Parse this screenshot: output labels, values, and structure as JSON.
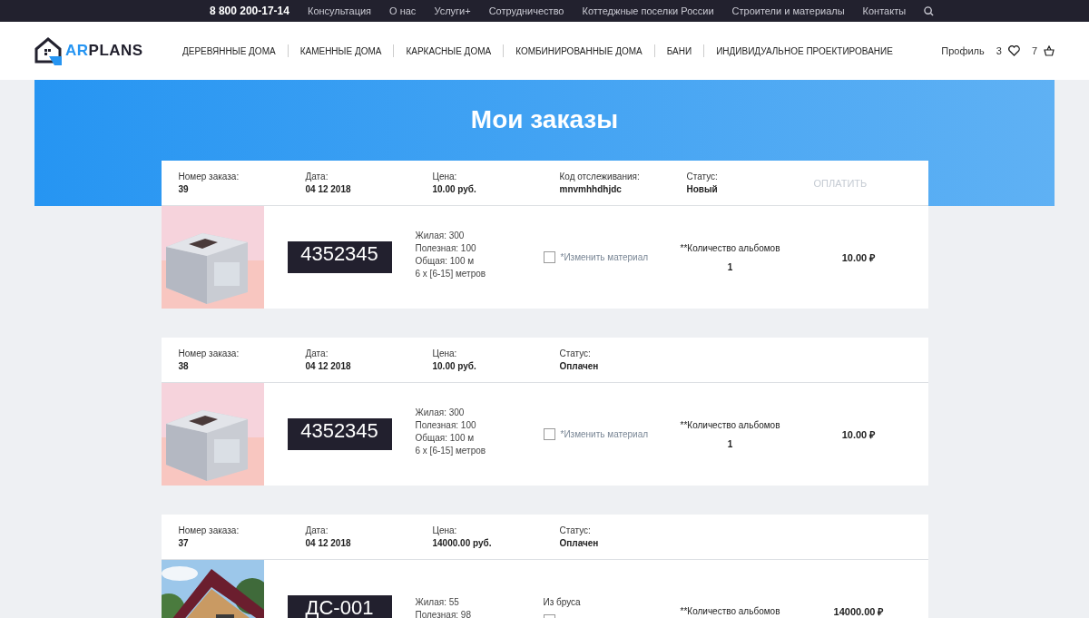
{
  "topbar": {
    "phone": "8 800 200-17-14",
    "links": [
      "Консультация",
      "О нас",
      "Услуги+",
      "Сотрудничество",
      "Коттеджные поселки России",
      "Строители и материалы",
      "Контакты"
    ]
  },
  "header": {
    "logo": {
      "accent": "AR",
      "rest": "PLANS"
    },
    "nav": [
      "ДЕРЕВЯННЫЕ ДОМА",
      "КАМЕННЫЕ ДОМА",
      "КАРКАСНЫЕ ДОМА",
      "КОМБИНИРОВАННЫЕ ДОМА",
      "БАНИ",
      "ИНДИВИДУАЛЬНОЕ ПРОЕКТИРОВАНИЕ"
    ],
    "profile": "Профиль",
    "favorites_count": "3",
    "cart_count": "7"
  },
  "title": "Мои заказы",
  "orders": [
    {
      "fields": [
        {
          "label": "Номер заказа:",
          "value": "39"
        },
        {
          "label": "Дата:",
          "value": "04 12 2018"
        },
        {
          "label": "Цена:",
          "value": "10.00 руб."
        },
        {
          "label": "Код отслеживания:",
          "value": "mnvmhhdhjdc"
        },
        {
          "label": "Статус:",
          "value": "Новый"
        }
      ],
      "pay_button": {
        "label": "ОПЛАТИТЬ",
        "disabled": true
      },
      "item": {
        "picture": {
          "kind": "picture"
        },
        "code": "4352345",
        "specs": [
          "Жилая: 300",
          "Полезная: 100",
          "Общая: 100 м",
          "6 x [6-15] метров"
        ],
        "checkbox": {
          "label": "*Изменить материал",
          "checked": false
        },
        "quantity_label": "**Количество альбомов",
        "quantity": "1",
        "price": "10.00 ₽"
      }
    },
    {
      "fields": [
        {
          "label": "Номер заказа:",
          "value": "38"
        },
        {
          "label": "Дата:",
          "value": "04 12 2018"
        },
        {
          "label": "Цена:",
          "value": "10.00 руб."
        },
        {
          "label": "Статус:",
          "value": "Оплачен"
        }
      ],
      "item": {
        "picture": {
          "kind": "picture"
        },
        "code": "4352345",
        "specs": [
          "Жилая: 300",
          "Полезная: 100",
          "Общая: 100 м",
          "6 x [6-15] метров"
        ],
        "checkbox": {
          "label": "*Изменить материал",
          "checked": false
        },
        "quantity_label": "**Количество альбомов",
        "quantity": "1",
        "price": "10.00 ₽"
      }
    },
    {
      "fields": [
        {
          "label": "Номер заказа:",
          "value": "37"
        },
        {
          "label": "Дата:",
          "value": "04 12 2018"
        },
        {
          "label": "Цена:",
          "value": "14000.00 руб."
        },
        {
          "label": "Статус:",
          "value": "Оплачен"
        }
      ],
      "item": {
        "picture": {
          "kind": "picture"
        },
        "code": "ДС-001",
        "specs": [
          "Жилая: 55",
          "Полезная: 98"
        ],
        "material": "Из бруса",
        "checkbox": {
          "checked": false
        },
        "quantity_label": "**Количество альбомов",
        "price": "14000.00 ₽"
      }
    }
  ]
}
